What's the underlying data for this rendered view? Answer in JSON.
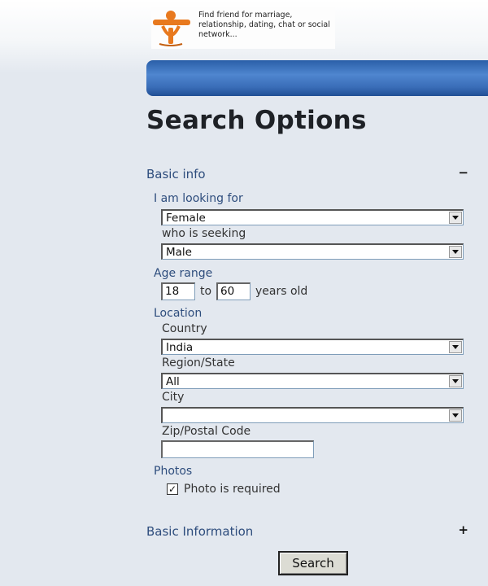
{
  "header": {
    "logo_text": "Find friend for marriage, relationship, dating, chat or social network...",
    "colors": {
      "logo_orange": "#e8791e",
      "bar_blue": "#3a6db8"
    }
  },
  "page": {
    "title": "Search Options"
  },
  "basic_info": {
    "label": "Basic info",
    "toggle": "−",
    "looking_for_label": "I am looking for",
    "looking_for_value": "Female",
    "seeking_label": "who is seeking",
    "seeking_value": "Male",
    "age_range_label": "Age range",
    "age_from": "18",
    "age_to_word": "to",
    "age_to": "60",
    "age_suffix": "years old",
    "location_label": "Location",
    "country_label": "Country",
    "country_value": "India",
    "region_label": "Region/State",
    "region_value": "All",
    "city_label": "City",
    "city_value": "",
    "zip_label": "Zip/Postal Code",
    "zip_value": "",
    "photos_label": "Photos",
    "photo_required_label": "Photo is required",
    "photo_required_checked": true,
    "check_glyph": "✓"
  },
  "basic_information": {
    "label": "Basic Information",
    "toggle": "+"
  },
  "actions": {
    "search_label": "Search"
  }
}
